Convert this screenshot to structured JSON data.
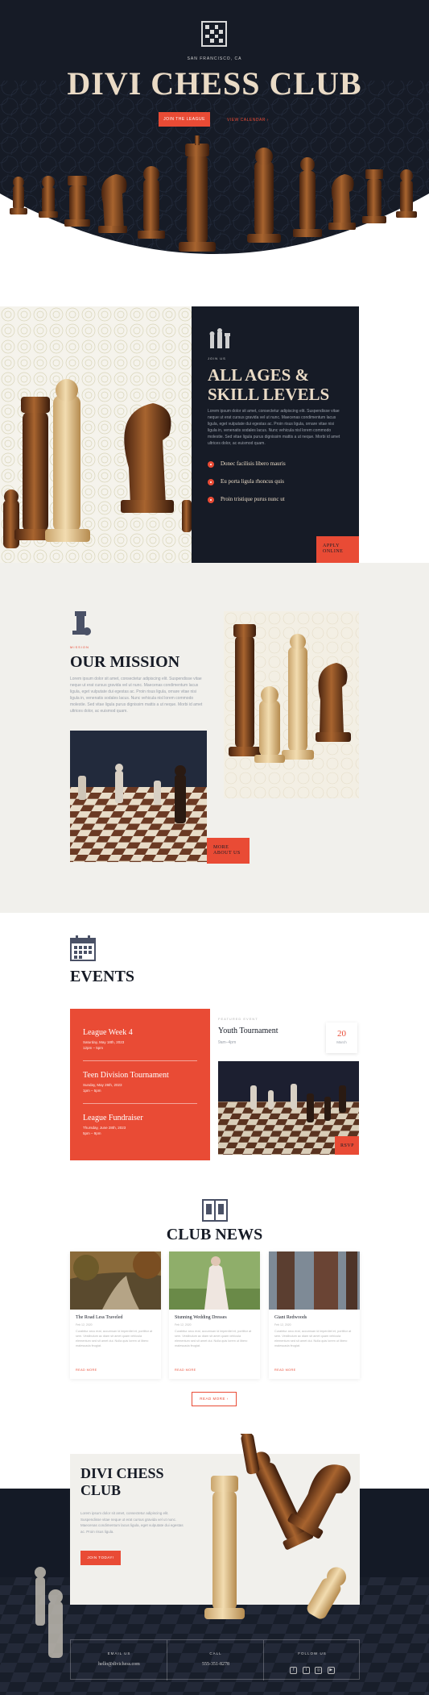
{
  "hero": {
    "location": "SAN FRANCISCO, CA",
    "title": "DIVI CHESS CLUB",
    "primary_button": "JOIN THE LEAGUE",
    "secondary_link": "VIEW CALENDAR"
  },
  "ages": {
    "label": "JOIN US",
    "title_line1": "ALL AGES &",
    "title_line2": "SKILL LEVELS",
    "body": "Lorem ipsum dolor sit amet, consectetur adipiscing elit. Suspendisse vitae neque ut erat cursus gravida vel ut nunc. Maecenas condimentum lacus ligula, eget vulputate dui egestas ac. Proin risus ligula, ornare vitae nisi ligula in, venenatis sodales lacus. Nunc vehicula nisl lorem commodo molestie. Sed vitae ligula purus dignissim mattis a ut neque. Morbi id amet ultrices dolor, ac euismod quam.",
    "bullets": [
      "Donec facilisis libero mauris",
      "Eu porta ligula rhoncus quis",
      "Proin tristique purus nunc ut"
    ],
    "apply_line1": "APPLY",
    "apply_line2": "ONLINE"
  },
  "mission": {
    "label": "MISSION",
    "title": "OUR MISSION",
    "body": "Lorem ipsum dolor sit amet, consectetur adipiscing elit. Suspendisse vitae neque ut erat cursus gravida vel ut nunc. Maecenas condimentum lacus ligula, eget vulputate dui egestas ac. Proin risus ligula, ornare vitae nisi ligula in, venenatis sodales lacus. Nunc vehicula nisl lorem commodo molestie. Sed vitae ligula purus dignissim mattis a ut neque. Morbi id amet ultrices dolor, ac euismod quam.",
    "button_line1": "MORE",
    "button_line2": "ABOUT US"
  },
  "events": {
    "title": "EVENTS",
    "list": [
      {
        "name": "League Week 4",
        "date": "Saturday, May 18th, 2023",
        "time": "12pm – 5pm"
      },
      {
        "name": "Teen Division Tournament",
        "date": "Sunday, May 26th, 2023",
        "time": "1pm – 5pm"
      },
      {
        "name": "League Fundraiser",
        "date": "Thursday, June 28th, 2023",
        "time": "5pm – 9pm"
      }
    ],
    "featured_label": "FEATURED EVENT",
    "featured_title": "Youth Tournament",
    "featured_time": "9am–4pm",
    "featured_day": "20",
    "featured_month": "March",
    "rsvp": "RSVP"
  },
  "news": {
    "title": "CLUB NEWS",
    "posts": [
      {
        "title": "The Road Less Traveled",
        "date": "Feb 12, 2020",
        "excerpt": "Curabitur arcu erat, accumsan id imperdiet et, porttitor at sem. Vestibulum ac diam sit amet quam vehicula elementum sed sit amet dui. Nulla quis lorem ut libero malesuada feugiat.",
        "read_more": "READ MORE"
      },
      {
        "title": "Stunning Wedding Dresses",
        "date": "Feb 12, 2020",
        "excerpt": "Curabitur arcu erat, accumsan id imperdiet et, porttitor at sem. Vestibulum ac diam sit amet quam vehicula elementum sed sit amet dui. Nulla quis lorem ut libero malesuada feugiat.",
        "read_more": "READ MORE"
      },
      {
        "title": "Giant Redwoods",
        "date": "Feb 12, 2020",
        "excerpt": "Curabitur arcu erat, accumsan id imperdiet et, porttitor at sem. Vestibulum ac diam sit amet quam vehicula elementum sed sit amet dui. Nulla quis lorem ut libero malesuada feugiat.",
        "read_more": "READ MORE"
      }
    ],
    "button": "READ MORE"
  },
  "cta": {
    "title_line1": "DIVI CHESS",
    "title_line2": "CLUB",
    "body": "Lorem ipsum dolor sit amet, consectetur adipiscing elit. Suspendisse vitae neque ut erat cursus gravida vel ut nunc. Maecenas condimentum lacus ligula, eget vulputate dui egestas ac. Proin risus ligula.",
    "button": "JOIN TODAY!"
  },
  "footer": {
    "email_label": "EMAIL US",
    "email": "hello@divichess.com",
    "call_label": "CALL",
    "phone": "555-351-8278",
    "follow_label": "FOLLOW US",
    "social_icons": [
      "facebook-icon",
      "twitter-icon",
      "instagram-icon",
      "youtube-icon"
    ]
  },
  "colors": {
    "navy": "#161b26",
    "accent": "#e94b35",
    "cream": "#eadbc6",
    "light_bg": "#f1f0ec"
  }
}
